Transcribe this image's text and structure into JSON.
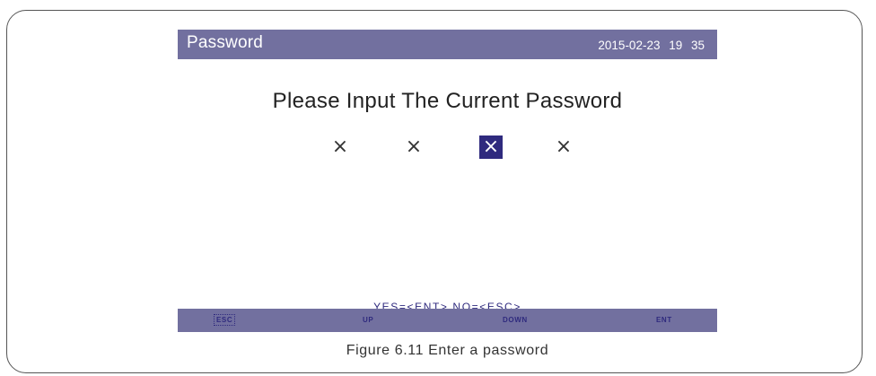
{
  "screen": {
    "title": "Password",
    "datetime": "2015-02-23 19 35",
    "prompt": "Please Input The Current Password",
    "digits": [
      {
        "value": "×",
        "selected": false
      },
      {
        "value": "×",
        "selected": false
      },
      {
        "value": "×",
        "selected": true
      },
      {
        "value": "×",
        "selected": false
      }
    ],
    "hint": "YES=<ENT>  NO=<ESC>"
  },
  "softkeys": {
    "esc": "ESC",
    "up": "UP",
    "down": "DOWN",
    "ent": "ENT"
  },
  "colors": {
    "bar": "#72709f",
    "accent": "#2f2a7e"
  },
  "caption": "Figure 6.11 Enter a password"
}
